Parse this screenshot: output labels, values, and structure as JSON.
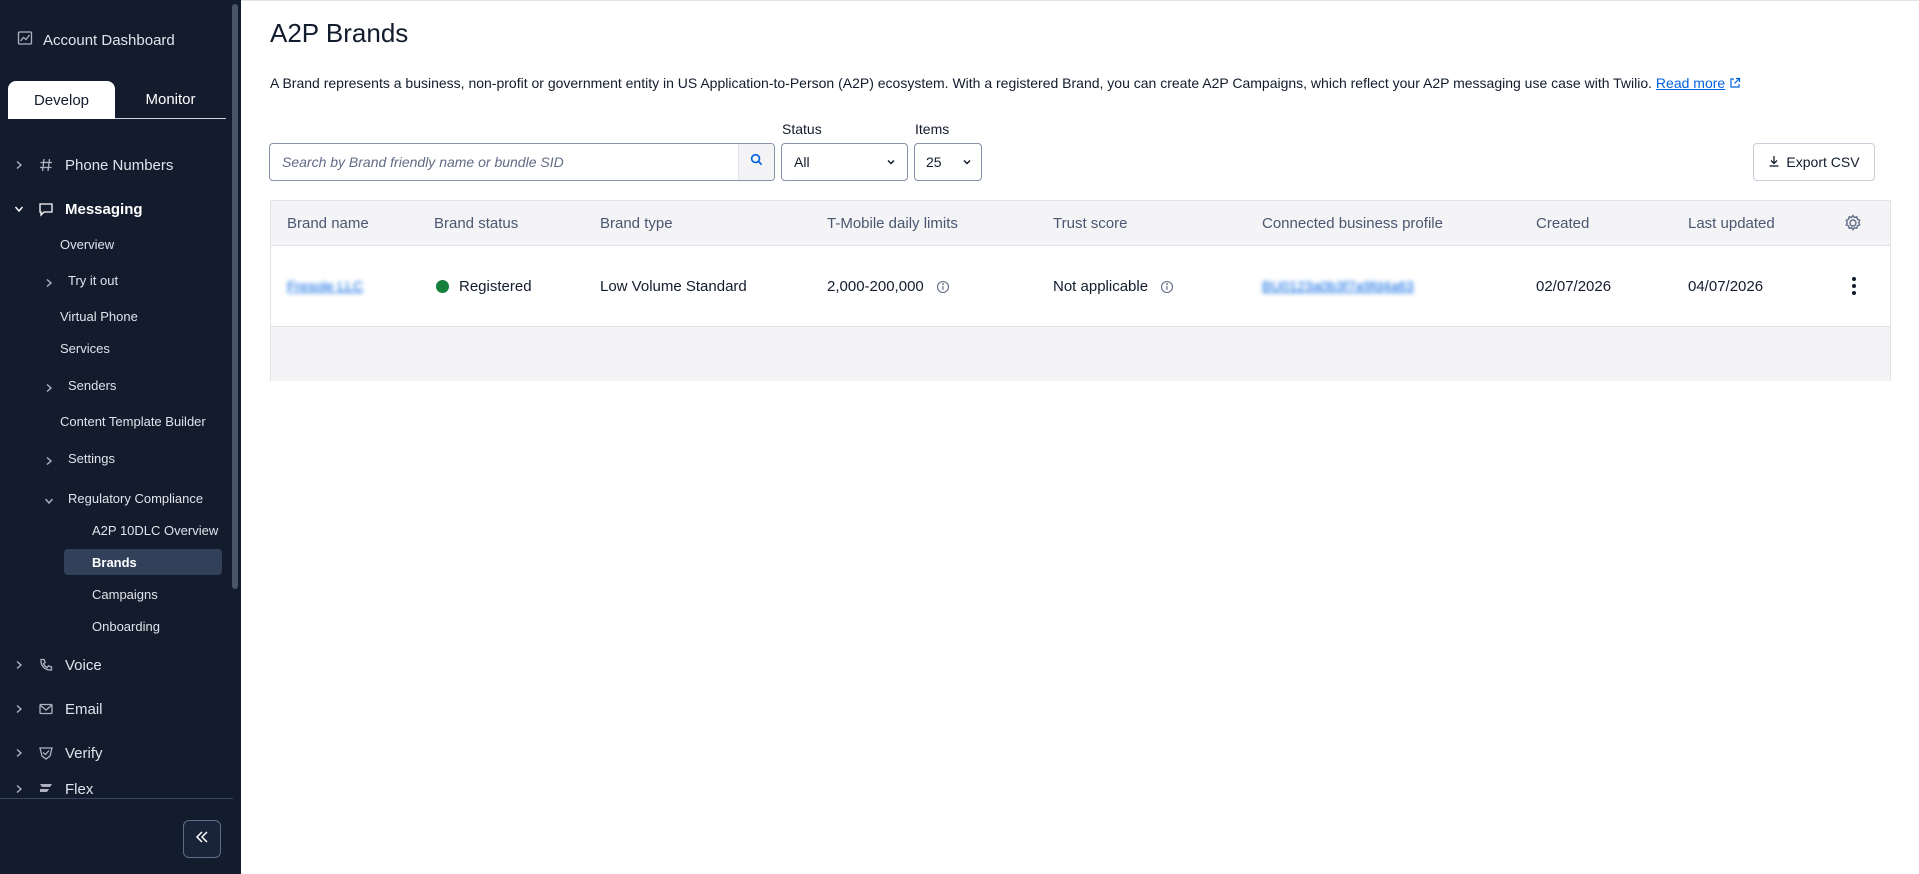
{
  "sidebar": {
    "account_dashboard": "Account Dashboard",
    "tabs": {
      "develop": "Develop",
      "monitor": "Monitor"
    },
    "items": {
      "phone_numbers": "Phone Numbers",
      "messaging": "Messaging",
      "overview": "Overview",
      "try_it_out": "Try it out",
      "virtual_phone": "Virtual Phone",
      "services": "Services",
      "senders": "Senders",
      "content_template_builder": "Content Template Builder",
      "settings": "Settings",
      "regulatory_compliance": "Regulatory Compliance",
      "a2p_overview": "A2P 10DLC Overview",
      "brands": "Brands",
      "campaigns": "Campaigns",
      "onboarding": "Onboarding",
      "voice": "Voice",
      "email": "Email",
      "verify": "Verify",
      "flex": "Flex"
    }
  },
  "page": {
    "title": "A2P Brands",
    "description": "A Brand represents a business, non-profit or government entity in US Application-to-Person (A2P) ecosystem. With a registered Brand, you can create A2P Campaigns, which reflect your A2P messaging use case with Twilio.",
    "read_more": "Read more"
  },
  "filters": {
    "search_placeholder": "Search by Brand friendly name or bundle SID",
    "status_label": "Status",
    "status_value": "All",
    "items_label": "Items",
    "items_value": "25",
    "export_label": "Export CSV"
  },
  "table": {
    "columns": [
      "Brand name",
      "Brand status",
      "Brand type",
      "T-Mobile daily limits",
      "Trust score",
      "Connected business profile",
      "Created",
      "Last updated"
    ],
    "rows": [
      {
        "brand_name": "Fresole LLC",
        "status": "Registered",
        "type": "Low Volume Standard",
        "tmobile_limits": "2,000-200,000",
        "trust_score": "Not applicable",
        "business_profile": "BU0123a0b3f7a9fd4a63",
        "created": "02/07/2026",
        "last_updated": "04/07/2026"
      }
    ]
  },
  "colors": {
    "sidebar_bg": "#121c2d",
    "link": "#0263e0",
    "status_registered": "#14803c"
  }
}
